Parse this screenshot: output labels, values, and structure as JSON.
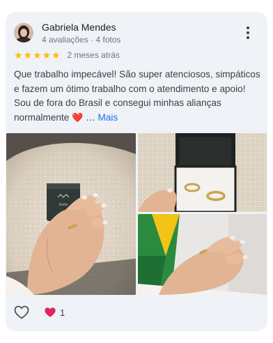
{
  "review": {
    "author_name": "Gabriela Mendes",
    "author_meta": "4 avaliações · 4 fotos",
    "rating": 5,
    "stars": [
      "★",
      "★",
      "★",
      "★",
      "★"
    ],
    "time_ago": "2 meses atrás",
    "text": "Que trabalho impecável! São super atenciosos, simpáticos e fazem um ótimo trabalho com o atendimento e apoio! Sou de fora do Brasil e consegui minhas alianças normalmente",
    "text_emoji": "❤️",
    "ellipsis": " … ",
    "more_label": "Mais",
    "photo_box_text": "Anéis"
  },
  "footer": {
    "like_icon": "heart-outline-icon",
    "reaction_icon": "red-heart-icon",
    "reaction_count": "1"
  },
  "colors": {
    "card_bg": "#eff3f8",
    "star": "#fbbc04",
    "link": "#1a73e8",
    "heart": "#e0245e"
  }
}
